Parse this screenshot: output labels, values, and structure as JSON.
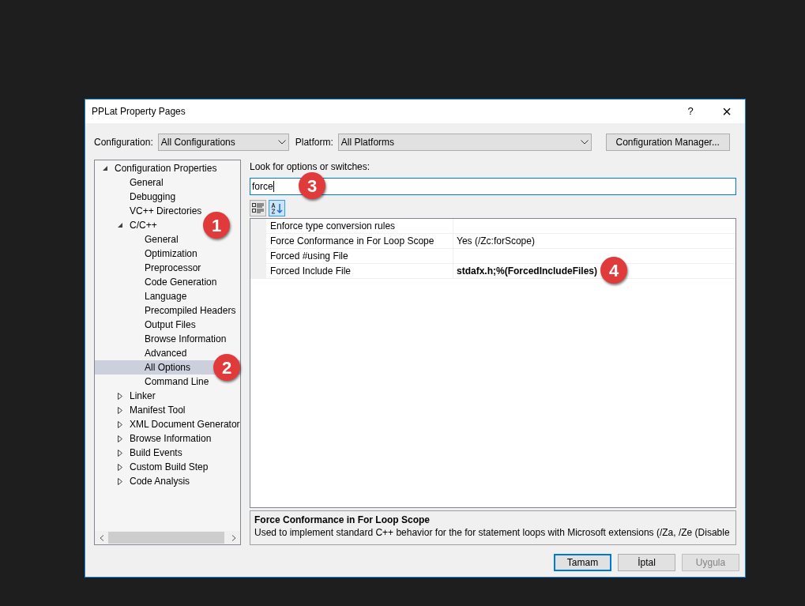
{
  "window": {
    "title": "PPLat Property Pages"
  },
  "title_buttons": [
    "?",
    "×"
  ],
  "configuration": {
    "label": "Configuration:",
    "value": "All Configurations"
  },
  "platform": {
    "label": "Platform:",
    "value": "All Platforms"
  },
  "config_manager": "Configuration Manager...",
  "tree": [
    {
      "label": "Configuration Properties",
      "expanded": true,
      "selected": false,
      "children": [
        {
          "label": "General",
          "selected": false
        },
        {
          "label": "Debugging",
          "selected": false
        },
        {
          "label": "VC++ Directories",
          "selected": false
        },
        {
          "label": "C/C++",
          "expanded": true,
          "selected": false,
          "badge": "1",
          "children": [
            {
              "label": "General",
              "selected": false
            },
            {
              "label": "Optimization",
              "selected": false
            },
            {
              "label": "Preprocessor",
              "selected": false
            },
            {
              "label": "Code Generation",
              "selected": false
            },
            {
              "label": "Language",
              "selected": false
            },
            {
              "label": "Precompiled Headers",
              "selected": false
            },
            {
              "label": "Output Files",
              "selected": false
            },
            {
              "label": "Browse Information",
              "selected": false
            },
            {
              "label": "Advanced",
              "selected": false
            },
            {
              "label": "All Options",
              "selected": true,
              "badge": "2"
            },
            {
              "label": "Command Line",
              "selected": false
            }
          ]
        },
        {
          "label": "Linker",
          "expanded": false,
          "selected": false
        },
        {
          "label": "Manifest Tool",
          "expanded": false,
          "selected": false
        },
        {
          "label": "XML Document Generator",
          "expanded": false,
          "selected": false
        },
        {
          "label": "Browse Information",
          "expanded": false,
          "selected": false
        },
        {
          "label": "Build Events",
          "expanded": false,
          "selected": false
        },
        {
          "label": "Custom Build Step",
          "expanded": false,
          "selected": false
        },
        {
          "label": "Code Analysis",
          "expanded": false,
          "selected": false
        }
      ]
    }
  ],
  "search": {
    "label": "Look for options or switches:",
    "value": "force",
    "badge": "3"
  },
  "view_buttons": [
    {
      "kind": "categorized",
      "selected": false
    },
    {
      "kind": "alphabetical",
      "selected": true
    }
  ],
  "properties": [
    {
      "name": "Enforce type conversion rules"
    },
    {
      "name": "Force Conformance in For Loop Scope",
      "value": "Yes (/Zc:forScope)",
      "bold": false
    },
    {
      "name": "Forced #using File"
    },
    {
      "name": "Forced Include File",
      "value": "stdafx.h;%(ForcedIncludeFiles)",
      "bold": true,
      "badge": "4"
    }
  ],
  "description": {
    "title": "Force Conformance in For Loop Scope",
    "text": "Used to implement standard C++ behavior for the for statement loops with Microsoft extensions (/Za, /Ze (Disable"
  },
  "buttons": [
    {
      "label": "Tamam",
      "kind": "default",
      "disabled": false
    },
    {
      "label": "İptal",
      "kind": "normal",
      "disabled": false
    },
    {
      "label": "Uygula",
      "kind": "normal",
      "disabled": true
    }
  ]
}
